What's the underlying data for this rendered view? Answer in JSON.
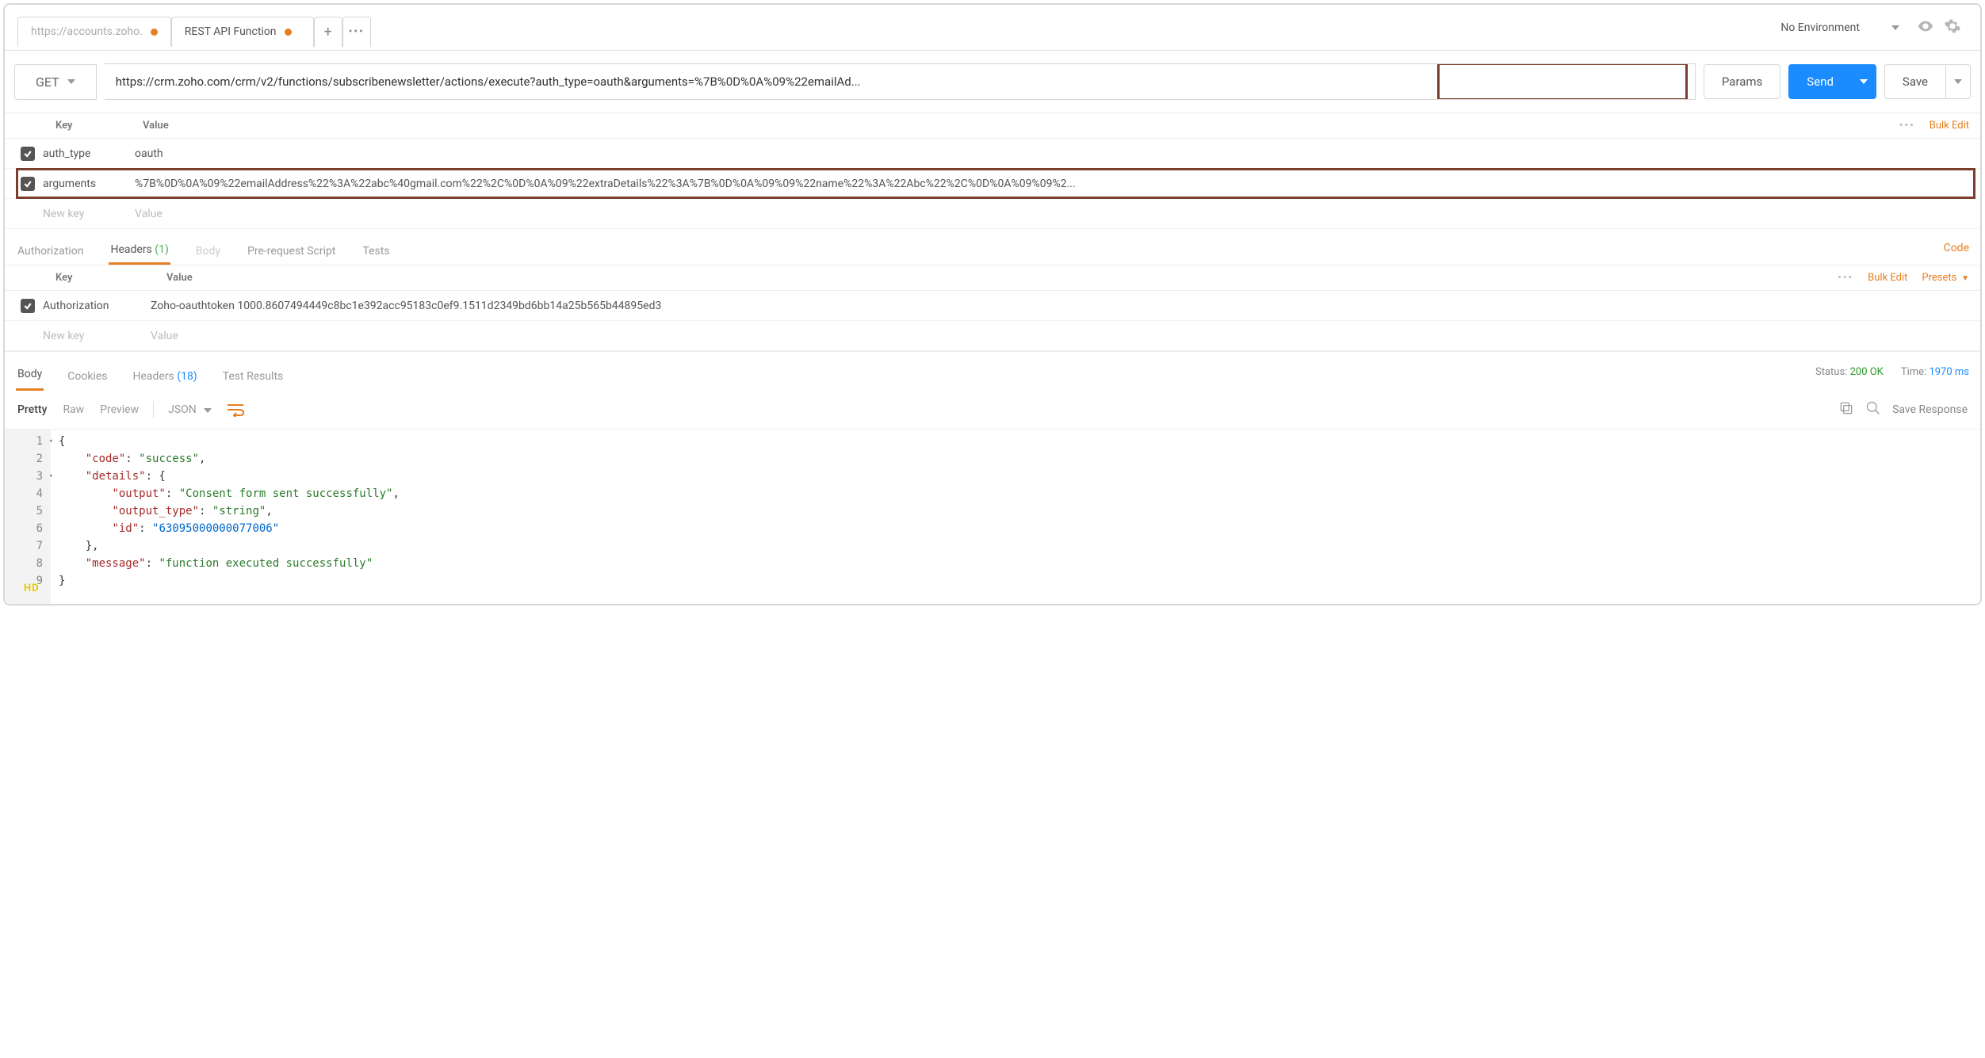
{
  "tabs": [
    {
      "label": "https://accounts.zoho.",
      "modified": true,
      "active": false
    },
    {
      "label": "REST API Function",
      "modified": true,
      "active": true
    }
  ],
  "envLabel": "No Environment",
  "request": {
    "method": "GET",
    "url": "https://crm.zoho.com/crm/v2/functions/subscribenewsletter/actions/execute?auth_type=oauth&arguments=%7B%0D%0A%09%22emailAd...",
    "paramsButton": "Params",
    "sendButton": "Send",
    "saveButton": "Save"
  },
  "paramsHeader": {
    "keyLabel": "Key",
    "valueLabel": "Value",
    "bulkEdit": "Bulk Edit"
  },
  "params": [
    {
      "checked": true,
      "key": "auth_type",
      "value": "oauth",
      "highlight": false
    },
    {
      "checked": true,
      "key": "arguments",
      "value": "%7B%0D%0A%09%22emailAddress%22%3A%22abc%40gmail.com%22%2C%0D%0A%09%22extraDetails%22%3A%7B%0D%0A%09%09%22name%22%3A%22Abc%22%2C%0D%0A%09%09%2...",
      "highlight": true
    }
  ],
  "paramsPlaceholder": {
    "key": "New key",
    "value": "Value"
  },
  "requestSubTabs": {
    "authorization": "Authorization",
    "headers": "Headers",
    "headersCount": "(1)",
    "body": "Body",
    "prerequest": "Pre-request Script",
    "tests": "Tests",
    "codeLink": "Code"
  },
  "headersTable": {
    "keyLabel": "Key",
    "valueLabel": "Value",
    "bulkEdit": "Bulk Edit",
    "presets": "Presets",
    "rows": [
      {
        "checked": true,
        "key": "Authorization",
        "value": "Zoho-oauthtoken 1000.8607494449c8bc1e392acc95183c0ef9.1511d2349bd6bb14a25b565b44895ed3"
      }
    ],
    "placeholder": {
      "key": "New key",
      "value": "Value"
    }
  },
  "responseTabs": {
    "body": "Body",
    "cookies": "Cookies",
    "headers": "Headers",
    "headersCount": "(18)",
    "testResults": "Test Results",
    "statusLabel": "Status:",
    "statusValue": "200 OK",
    "timeLabel": "Time:",
    "timeValue": "1970 ms"
  },
  "viewBar": {
    "pretty": "Pretty",
    "raw": "Raw",
    "preview": "Preview",
    "format": "JSON",
    "saveResponse": "Save Response"
  },
  "responseBody": {
    "lines": [
      "{",
      "    \"code\": \"success\",",
      "    \"details\": {",
      "        \"output\": \"Consent form sent successfully\",",
      "        \"output_type\": \"string\",",
      "        \"id\": \"63095000000077006\"",
      "    },",
      "    \"message\": \"function executed successfully\"",
      "}"
    ]
  },
  "badge": "HD"
}
